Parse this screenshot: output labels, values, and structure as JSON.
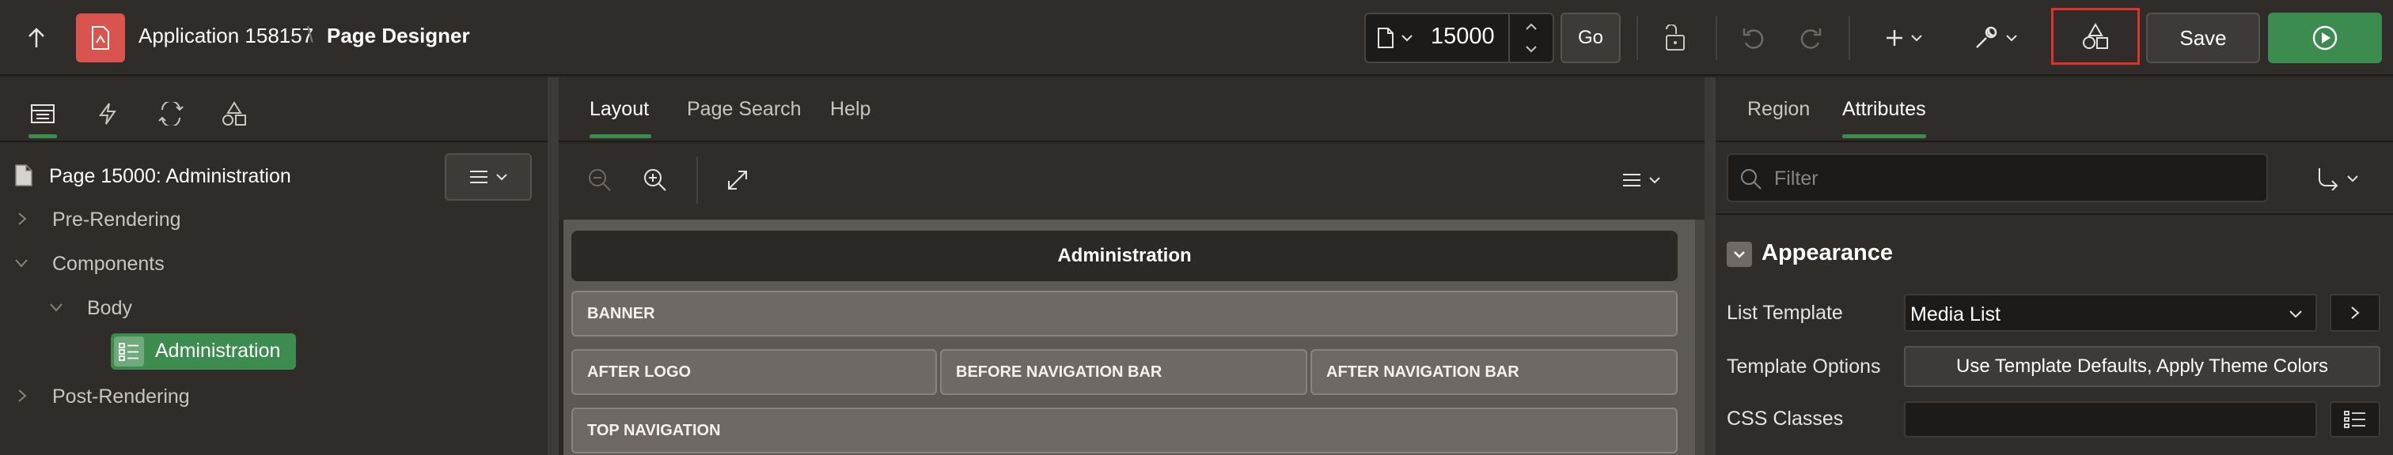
{
  "header": {
    "app_name": "Application 158157",
    "separator": "\\",
    "title": "Page Designer",
    "page_number": "15000",
    "go_label": "Go",
    "save_label": "Save"
  },
  "left": {
    "page_title": "Page 15000: Administration",
    "tree": {
      "pre_rendering": "Pre-Rendering",
      "components": "Components",
      "body": "Body",
      "administration": "Administration",
      "post_rendering": "Post-Rendering"
    }
  },
  "center": {
    "tabs": [
      "Layout",
      "Page Search",
      "Help"
    ],
    "region_title": "Administration",
    "slots": {
      "banner": "BANNER",
      "after_logo": "AFTER LOGO",
      "before_nav": "BEFORE NAVIGATION BAR",
      "after_nav": "AFTER NAVIGATION BAR",
      "top_nav": "TOP NAVIGATION"
    }
  },
  "right": {
    "tabs": [
      "Region",
      "Attributes"
    ],
    "filter_placeholder": "Filter",
    "section_title": "Appearance",
    "fields": {
      "list_template_label": "List Template",
      "list_template_value": "Media List",
      "template_options_label": "Template Options",
      "template_options_value": "Use Template Defaults, Apply Theme Colors",
      "css_classes_label": "CSS Classes",
      "css_classes_value": ""
    }
  },
  "colors": {
    "accent_green": "#3c8b4f",
    "app_icon_red": "#d9534f",
    "highlight_red": "#e0322b"
  }
}
